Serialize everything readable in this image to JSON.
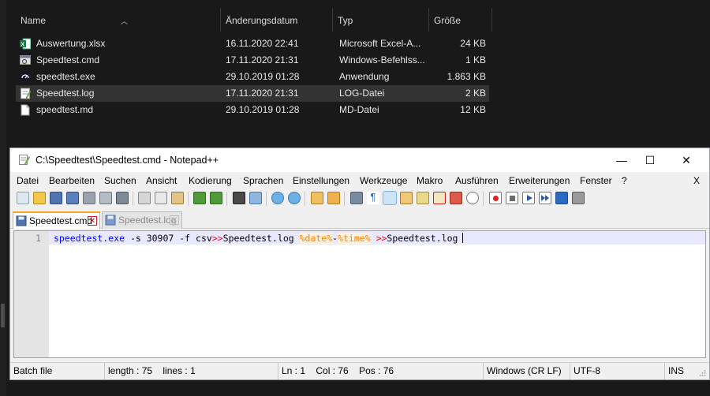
{
  "explorer": {
    "columns": {
      "name": "Name",
      "date": "Änderungsdatum",
      "type": "Typ",
      "size": "Größe"
    },
    "files": [
      {
        "name": "Auswertung.xlsx",
        "date": "16.11.2020 22:41",
        "type": "Microsoft Excel-A...",
        "size": "24 KB",
        "icon": "excel-file-icon"
      },
      {
        "name": "Speedtest.cmd",
        "date": "17.11.2020 21:31",
        "type": "Windows-Befehlss...",
        "size": "1 KB",
        "icon": "cmd-file-icon"
      },
      {
        "name": "speedtest.exe",
        "date": "29.10.2019 01:28",
        "type": "Anwendung",
        "size": "1.863 KB",
        "icon": "speedtest-exe-icon"
      },
      {
        "name": "Speedtest.log",
        "date": "17.11.2020 21:31",
        "type": "LOG-Datei",
        "size": "2 KB",
        "icon": "notepadpp-file-icon"
      },
      {
        "name": "speedtest.md",
        "date": "29.10.2019 01:28",
        "type": "MD-Datei",
        "size": "12 KB",
        "icon": "blank-file-icon"
      }
    ]
  },
  "npp": {
    "title": "C:\\Speedtest\\Speedtest.cmd - Notepad++",
    "window_buttons": {
      "minimize": "—",
      "maximize": "☐",
      "close": "✕"
    },
    "menu": [
      "Datei",
      "Bearbeiten",
      "Suchen",
      "Ansicht",
      "Kodierung",
      "Sprachen",
      "Einstellungen",
      "Werkzeuge",
      "Makro",
      "Ausführen",
      "Erweiterungen",
      "Fenster",
      "?"
    ],
    "menu_close": "X",
    "tabs": [
      {
        "label": "Speedtest.cmd",
        "close": "✕"
      },
      {
        "label": "Speedtest.log",
        "close": "✕"
      }
    ],
    "editor": {
      "line_number": "1",
      "tokens": [
        {
          "text": "speedtest.exe",
          "kind": "cmd"
        },
        {
          "text": " -s 30907 -f csv",
          "kind": "txt"
        },
        {
          "text": ">>",
          "kind": "op"
        },
        {
          "text": "Speedtest.log ",
          "kind": "txt"
        },
        {
          "text": "%date%",
          "kind": "var"
        },
        {
          "text": "-",
          "kind": "txt"
        },
        {
          "text": "%time%",
          "kind": "var"
        },
        {
          "text": " ",
          "kind": "txt"
        },
        {
          "text": ">>",
          "kind": "op"
        },
        {
          "text": "Speedtest.log",
          "kind": "txt"
        }
      ]
    },
    "status": {
      "lang": "Batch file",
      "length": "length : 75",
      "lines": "lines : 1",
      "ln": "Ln : 1",
      "col": "Col : 76",
      "pos": "Pos : 76",
      "eol": "Windows (CR LF)",
      "encoding": "UTF-8",
      "mode": "INS"
    },
    "colors": {
      "command": "#0000ff",
      "operator": "#ff0000",
      "variable": "#ff8000",
      "current_line": "#e8e8ff",
      "active_tab_accent": "#f5a623"
    }
  }
}
